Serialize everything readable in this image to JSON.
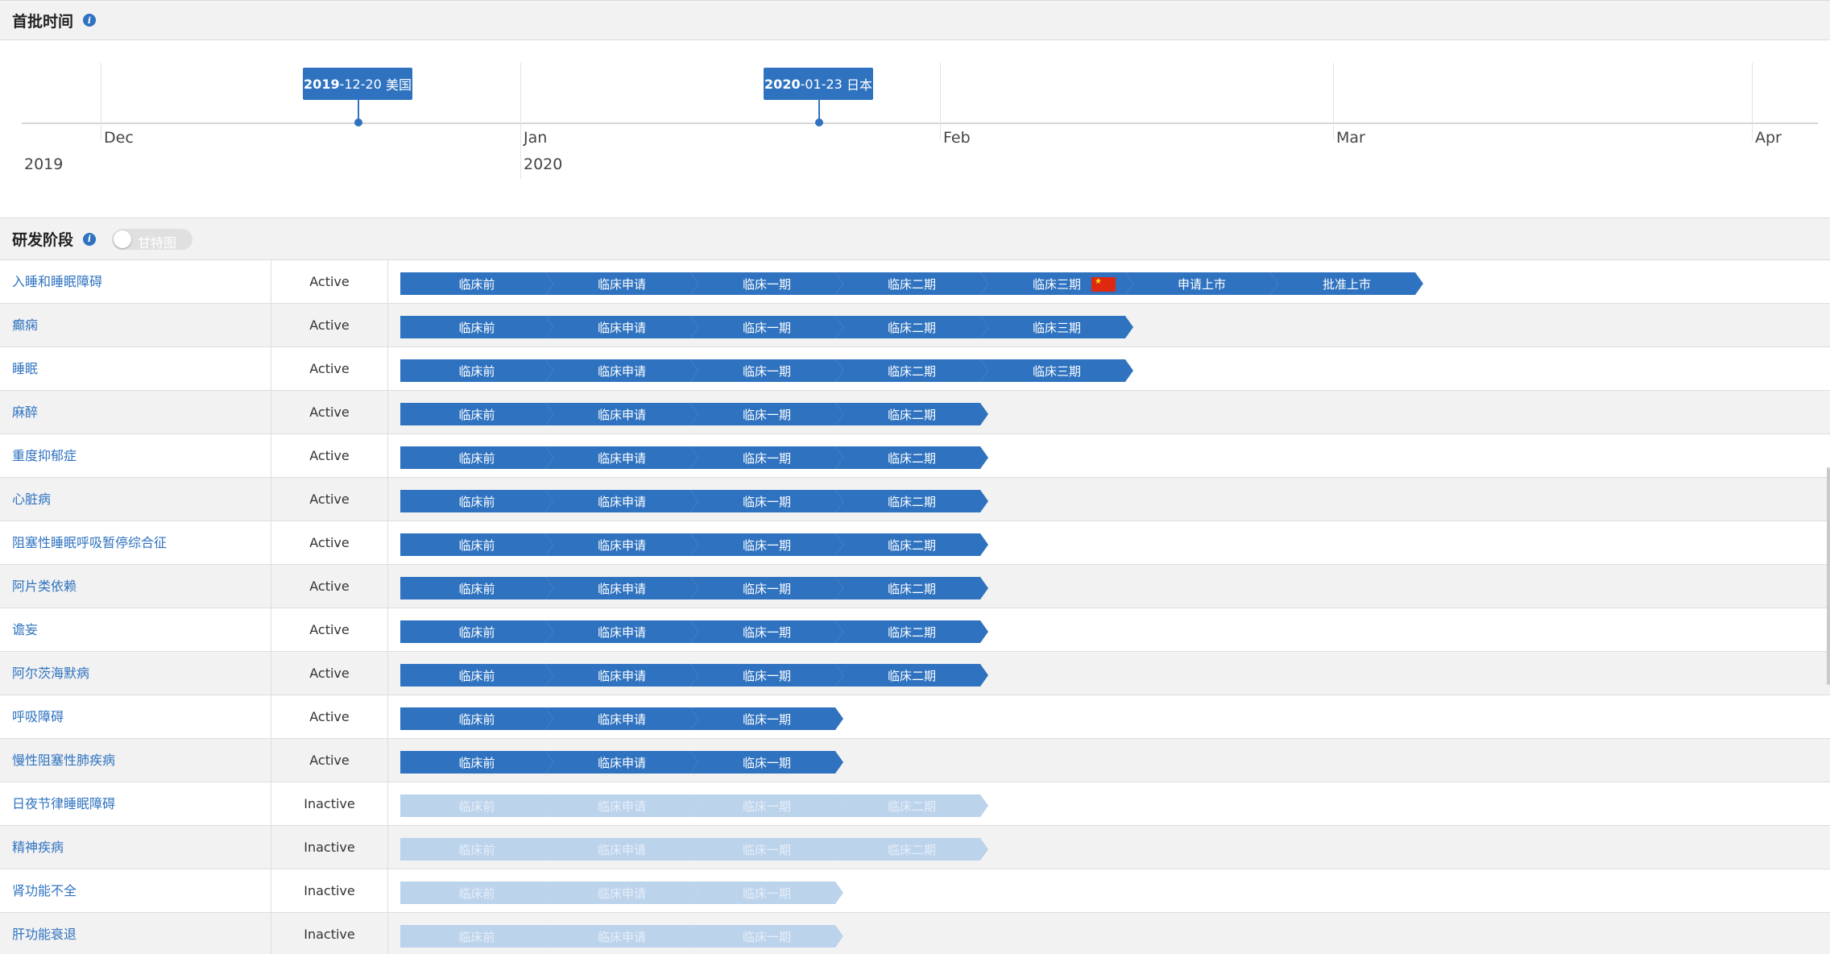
{
  "sections": {
    "first_approval": {
      "title": "首批时间"
    },
    "rd_stage": {
      "title": "研发阶段",
      "toggle_label": "甘特图"
    }
  },
  "timeline": {
    "months": [
      {
        "label": "Dec"
      },
      {
        "label": "Jan"
      },
      {
        "label": "Feb"
      },
      {
        "label": "Mar"
      },
      {
        "label": "Apr"
      }
    ],
    "years": [
      {
        "label": "2019"
      },
      {
        "label": "2020"
      }
    ],
    "events": [
      {
        "year": "2019",
        "date": "-12-20",
        "country": "美国"
      },
      {
        "year": "2020",
        "date": "-01-23",
        "country": "日本"
      }
    ]
  },
  "stage_names": [
    "临床前",
    "临床申请",
    "临床一期",
    "临床二期",
    "临床三期",
    "申请上市",
    "批准上市"
  ],
  "colors": {
    "accent": "#2f73c0",
    "inactive": "#bcd3ec",
    "china_flag": "#de2910"
  },
  "rows": [
    {
      "name": "入睡和睡眠障碍",
      "status": "Active",
      "stages": [
        "临床前",
        "临床申请",
        "临床一期",
        "临床二期",
        "临床三期",
        "申请上市",
        "批准上市"
      ],
      "flag_stage": 4,
      "flag": "china-flag-icon"
    },
    {
      "name": "癫痫",
      "status": "Active",
      "stages": [
        "临床前",
        "临床申请",
        "临床一期",
        "临床二期",
        "临床三期"
      ]
    },
    {
      "name": "睡眠",
      "status": "Active",
      "stages": [
        "临床前",
        "临床申请",
        "临床一期",
        "临床二期",
        "临床三期"
      ]
    },
    {
      "name": "麻醉",
      "status": "Active",
      "stages": [
        "临床前",
        "临床申请",
        "临床一期",
        "临床二期"
      ]
    },
    {
      "name": "重度抑郁症",
      "status": "Active",
      "stages": [
        "临床前",
        "临床申请",
        "临床一期",
        "临床二期"
      ]
    },
    {
      "name": "心脏病",
      "status": "Active",
      "stages": [
        "临床前",
        "临床申请",
        "临床一期",
        "临床二期"
      ]
    },
    {
      "name": "阻塞性睡眠呼吸暂停综合征",
      "status": "Active",
      "stages": [
        "临床前",
        "临床申请",
        "临床一期",
        "临床二期"
      ]
    },
    {
      "name": "阿片类依赖",
      "status": "Active",
      "stages": [
        "临床前",
        "临床申请",
        "临床一期",
        "临床二期"
      ]
    },
    {
      "name": "谵妄",
      "status": "Active",
      "stages": [
        "临床前",
        "临床申请",
        "临床一期",
        "临床二期"
      ]
    },
    {
      "name": "阿尔茨海默病",
      "status": "Active",
      "stages": [
        "临床前",
        "临床申请",
        "临床一期",
        "临床二期"
      ]
    },
    {
      "name": "呼吸障碍",
      "status": "Active",
      "stages": [
        "临床前",
        "临床申请",
        "临床一期"
      ]
    },
    {
      "name": "慢性阻塞性肺疾病",
      "status": "Active",
      "stages": [
        "临床前",
        "临床申请",
        "临床一期"
      ]
    },
    {
      "name": "日夜节律睡眠障碍",
      "status": "Inactive",
      "stages": [
        "临床前",
        "临床申请",
        "临床一期",
        "临床二期"
      ]
    },
    {
      "name": "精神疾病",
      "status": "Inactive",
      "stages": [
        "临床前",
        "临床申请",
        "临床一期",
        "临床二期"
      ]
    },
    {
      "name": "肾功能不全",
      "status": "Inactive",
      "stages": [
        "临床前",
        "临床申请",
        "临床一期"
      ]
    },
    {
      "name": "肝功能衰退",
      "status": "Inactive",
      "stages": [
        "临床前",
        "临床申请",
        "临床一期"
      ]
    }
  ]
}
